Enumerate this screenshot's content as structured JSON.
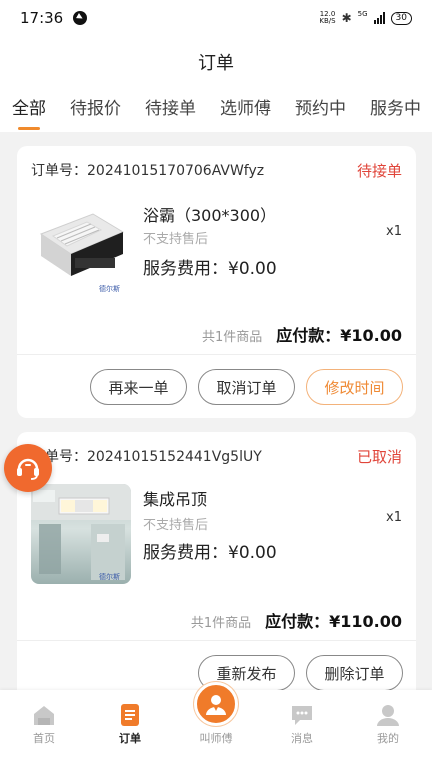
{
  "status_bar": {
    "time": "17:36",
    "net_speed_value": "12.0",
    "net_speed_unit": "KB/S",
    "network_label": "5G",
    "battery": "30"
  },
  "header": {
    "title": "订单"
  },
  "tabs": [
    {
      "label": "全部",
      "active": true
    },
    {
      "label": "待报价"
    },
    {
      "label": "待接单"
    },
    {
      "label": "选师傅"
    },
    {
      "label": "预约中"
    },
    {
      "label": "服务中"
    }
  ],
  "orders": [
    {
      "order_no": "订单号：20241015170706AVWfyz",
      "status": "待接单",
      "status_color": "#e0453a",
      "product_name": "浴霸（300*300）",
      "note": "不支持售后",
      "fee": "服务费用：¥0.00",
      "qty": "x1",
      "count": "共1件商品",
      "pay": "应付款：¥10.00",
      "buttons": [
        "再来一单",
        "取消订单",
        "修改时间"
      ]
    },
    {
      "order_no": "订单号：20241015152441Vg5lUY",
      "status": "已取消",
      "status_color": "#e0453a",
      "product_name": "集成吊顶",
      "note": "不支持售后",
      "fee": "服务费用：¥0.00",
      "qty": "x1",
      "count": "共1件商品",
      "pay": "应付款：¥110.00",
      "buttons": [
        "重新发布",
        "删除订单"
      ]
    }
  ],
  "product_brand_label": "德尔斯",
  "bottom_nav": [
    {
      "label": "首页",
      "icon": "home-icon"
    },
    {
      "label": "订单",
      "icon": "order-icon",
      "active": true
    },
    {
      "label": "叫师傅",
      "icon": "worker-icon"
    },
    {
      "label": "消息",
      "icon": "message-icon"
    },
    {
      "label": "我的",
      "icon": "profile-icon"
    }
  ],
  "colors": {
    "accent": "#f08a2c",
    "status_red": "#e0453a",
    "support_fab": "#f0692e"
  }
}
